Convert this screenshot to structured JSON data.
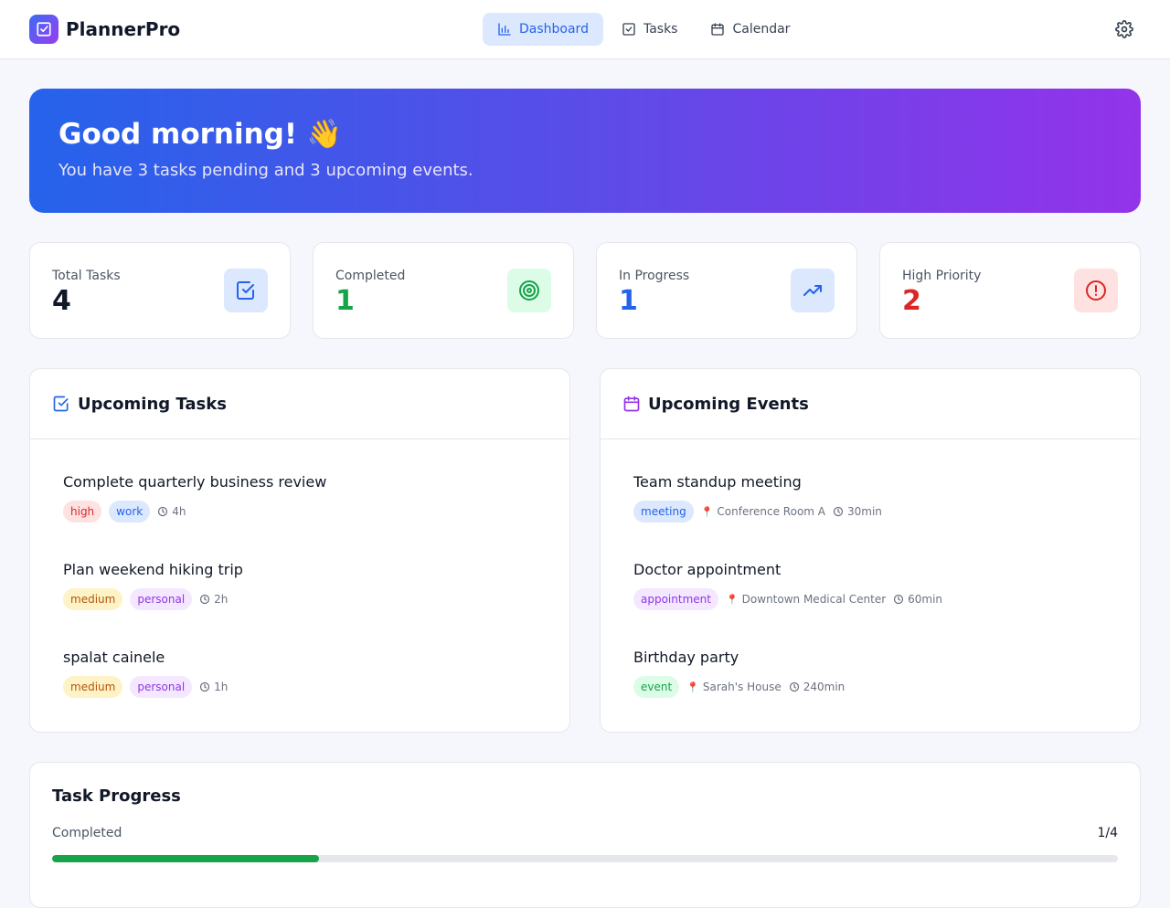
{
  "app": {
    "name": "PlannerPro"
  },
  "nav": [
    {
      "label": "Dashboard",
      "icon": "bar-chart-icon",
      "active": true
    },
    {
      "label": "Tasks",
      "icon": "check-square-icon",
      "active": false
    },
    {
      "label": "Calendar",
      "icon": "calendar-icon",
      "active": false
    }
  ],
  "hero": {
    "greeting": "Good morning! 👋",
    "summary": "You have 3 tasks pending and 3 upcoming events."
  },
  "stats": [
    {
      "label": "Total Tasks",
      "value": "4",
      "color": "#111827",
      "icon": "check-square-icon",
      "icon_bg": "#dbe8fd",
      "icon_color": "#2563eb"
    },
    {
      "label": "Completed",
      "value": "1",
      "color": "#16a34a",
      "icon": "target-icon",
      "icon_bg": "#dcfce7",
      "icon_color": "#16a34a"
    },
    {
      "label": "In Progress",
      "value": "1",
      "color": "#2563eb",
      "icon": "trending-up-icon",
      "icon_bg": "#dbe8fd",
      "icon_color": "#2563eb"
    },
    {
      "label": "High Priority",
      "value": "2",
      "color": "#dc2626",
      "icon": "alert-circle-icon",
      "icon_bg": "#fee2e2",
      "icon_color": "#dc2626"
    }
  ],
  "tasks_panel": {
    "title": "Upcoming Tasks",
    "items": [
      {
        "title": "Complete quarterly business review",
        "priority": "high",
        "category": "work",
        "duration": "4h"
      },
      {
        "title": "Plan weekend hiking trip",
        "priority": "medium",
        "category": "personal",
        "duration": "2h"
      },
      {
        "title": "spalat cainele",
        "priority": "medium",
        "category": "personal",
        "duration": "1h"
      }
    ]
  },
  "events_panel": {
    "title": "Upcoming Events",
    "items": [
      {
        "title": "Team standup meeting",
        "type": "meeting",
        "location": "Conference Room A",
        "duration": "30min"
      },
      {
        "title": "Doctor appointment",
        "type": "appointment",
        "location": "Downtown Medical Center",
        "duration": "60min"
      },
      {
        "title": "Birthday party",
        "type": "event",
        "location": "Sarah's House",
        "duration": "240min"
      }
    ]
  },
  "progress": {
    "title": "Task Progress",
    "label": "Completed",
    "count": "1/4",
    "fraction": 0.25
  },
  "colors": {
    "accent": "#2563eb",
    "purple": "#9333ea",
    "success": "#16a34a",
    "danger": "#dc2626"
  },
  "tag_styles": {
    "high": {
      "bg": "#fee2e2",
      "fg": "#dc2626"
    },
    "medium": {
      "bg": "#fef3c7",
      "fg": "#b45309"
    },
    "work": {
      "bg": "#dbe8fd",
      "fg": "#2563eb"
    },
    "personal": {
      "bg": "#f3e8ff",
      "fg": "#9333ea"
    },
    "meeting": {
      "bg": "#dbe8fd",
      "fg": "#2563eb"
    },
    "appointment": {
      "bg": "#f3e8ff",
      "fg": "#9333ea"
    },
    "event": {
      "bg": "#dcfce7",
      "fg": "#16a34a"
    }
  }
}
